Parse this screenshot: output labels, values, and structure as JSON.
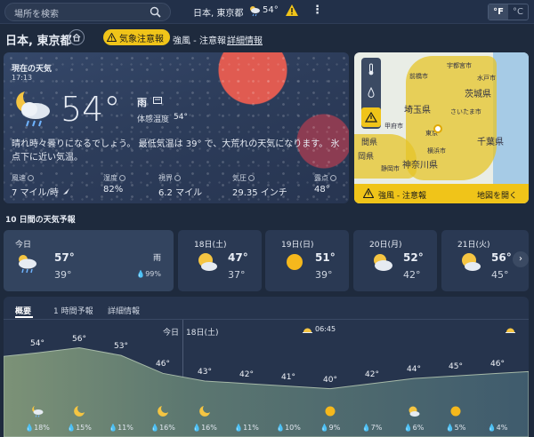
{
  "top": {
    "search_placeholder": "場所を検索",
    "location": "日本, 東京都",
    "temp": "54°",
    "unit_f": "°F",
    "unit_c": "°C"
  },
  "header": {
    "location": "日本, 東京都",
    "alert_pill": "気象注意報",
    "alert_text": "強風 - 注意報",
    "alert_link": "詳細情報"
  },
  "current": {
    "title": "現在の天気",
    "time": "17:13",
    "temp": "54°",
    "condition": "雨",
    "feels_label": "体感温度",
    "feels_value": "54°",
    "description": "晴れ時々曇りになるでしょう。 最低気温は 39° で、大荒れの天気になります。 氷点下に近い気温。",
    "stats": [
      {
        "label": "風速",
        "value": "7 マイル/時"
      },
      {
        "label": "湿度",
        "value": "82%"
      },
      {
        "label": "視界",
        "value": "6.2 マイル"
      },
      {
        "label": "気圧",
        "value": "29.35 インチ"
      },
      {
        "label": "露点",
        "value": "48°"
      }
    ]
  },
  "map": {
    "labels": [
      "宇都宮市",
      "水戸市",
      "茨城県",
      "前橋市",
      "埼玉県",
      "さいたま市",
      "甲府市",
      "東京",
      "千葉県",
      "静岡市",
      "神奈川県",
      "横浜市",
      "間県",
      "岡県"
    ],
    "footer_label": "強風 - 注意報",
    "footer_link": "地図を開く"
  },
  "forecast": {
    "title": "10 日間の天気予報",
    "days": [
      {
        "name": "今日",
        "hi": "57°",
        "lo": "39°",
        "extra": "雨",
        "precip": "99%",
        "icon": "cloud-rain-sun"
      },
      {
        "name": "18日(土)",
        "hi": "47°",
        "lo": "37°",
        "icon": "sun-cloud"
      },
      {
        "name": "19日(日)",
        "hi": "51°",
        "lo": "39°",
        "icon": "sun"
      },
      {
        "name": "20日(月)",
        "hi": "52°",
        "lo": "42°",
        "icon": "sun-cloud"
      },
      {
        "name": "21日(火)",
        "hi": "56°",
        "lo": "45°",
        "icon": "sun-cloud"
      }
    ],
    "next": "›"
  },
  "hourly": {
    "tabs": [
      "概要",
      "1 時間予報",
      "詳細情報"
    ],
    "today_label": "今日",
    "next_day_label": "18日(土)",
    "sunrise_time": "06:45",
    "temps": [
      "54°",
      "56°",
      "53°",
      "46°",
      "43°",
      "42°",
      "41°",
      "40°",
      "42°",
      "44°",
      "45°",
      "46°"
    ],
    "precip": [
      "18%",
      "15%",
      "11%",
      "16%",
      "16%",
      "11%",
      "10%",
      "9%",
      "7%",
      "6%",
      "5%",
      "4%"
    ],
    "icons": [
      "cloud-rain-moon",
      "moon",
      "",
      "moon",
      "moon",
      "",
      "",
      "sun",
      "",
      "sun-cloud",
      "sun",
      ""
    ]
  },
  "colors": {
    "background": "#1e2a3d",
    "alert": "#f0c419",
    "chart_fill": "#6f8d74"
  }
}
